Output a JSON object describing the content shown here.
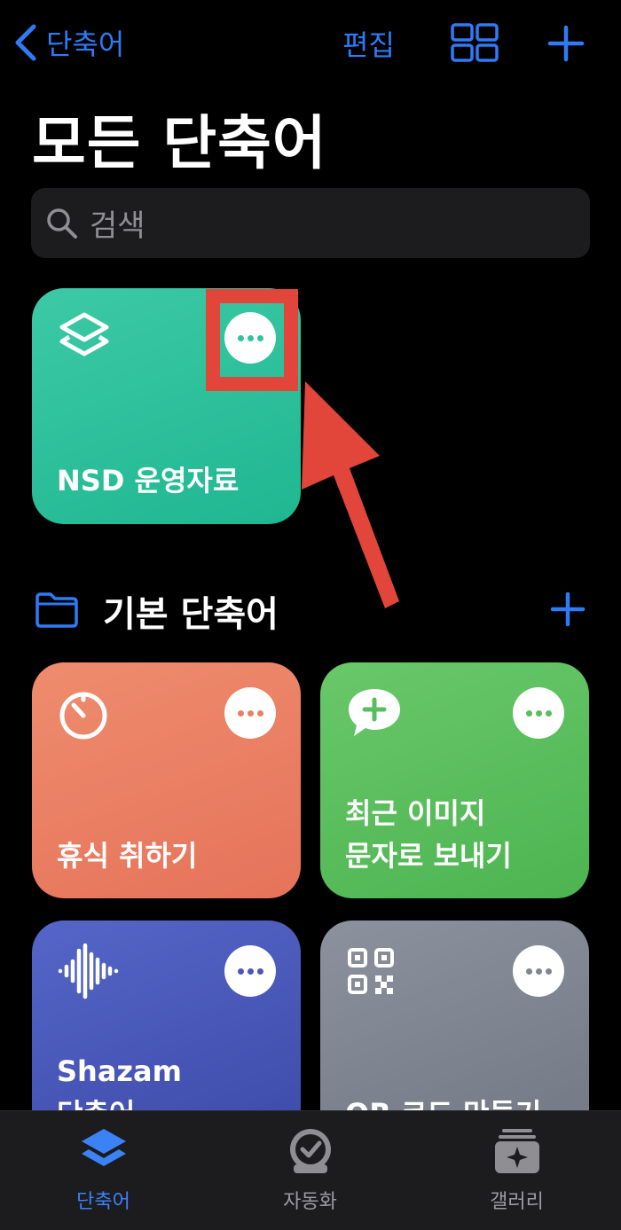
{
  "nav": {
    "back_label": "단축어",
    "edit_label": "편집"
  },
  "page_title": "모든 단축어",
  "search": {
    "placeholder": "검색"
  },
  "shortcuts_top": [
    {
      "label": "NSD 운영자료",
      "color": "#2ec4a0"
    }
  ],
  "folder": {
    "title": "기본 단축어"
  },
  "shortcuts": [
    {
      "label_line1": "휴식 취하기",
      "color": "#ec7e63"
    },
    {
      "label_line1": "최근 이미지",
      "label_line2": "문자로 보내기",
      "color": "#5abd5d"
    },
    {
      "label_line1": "Shazam",
      "label_line2": "단축어",
      "color": "#4a57b8"
    },
    {
      "label_line1": "QR 코드 만들기",
      "color": "#7f8591"
    }
  ],
  "tabs": [
    {
      "label": "단축어",
      "active": true,
      "icon": "layers-icon"
    },
    {
      "label": "자동화",
      "active": false,
      "icon": "clock-check-icon"
    },
    {
      "label": "갤러리",
      "active": false,
      "icon": "gallery-sparkle-icon"
    }
  ],
  "colors": {
    "accent": "#2f7bf6",
    "annotation_red": "#e2463a",
    "background": "#000000"
  }
}
